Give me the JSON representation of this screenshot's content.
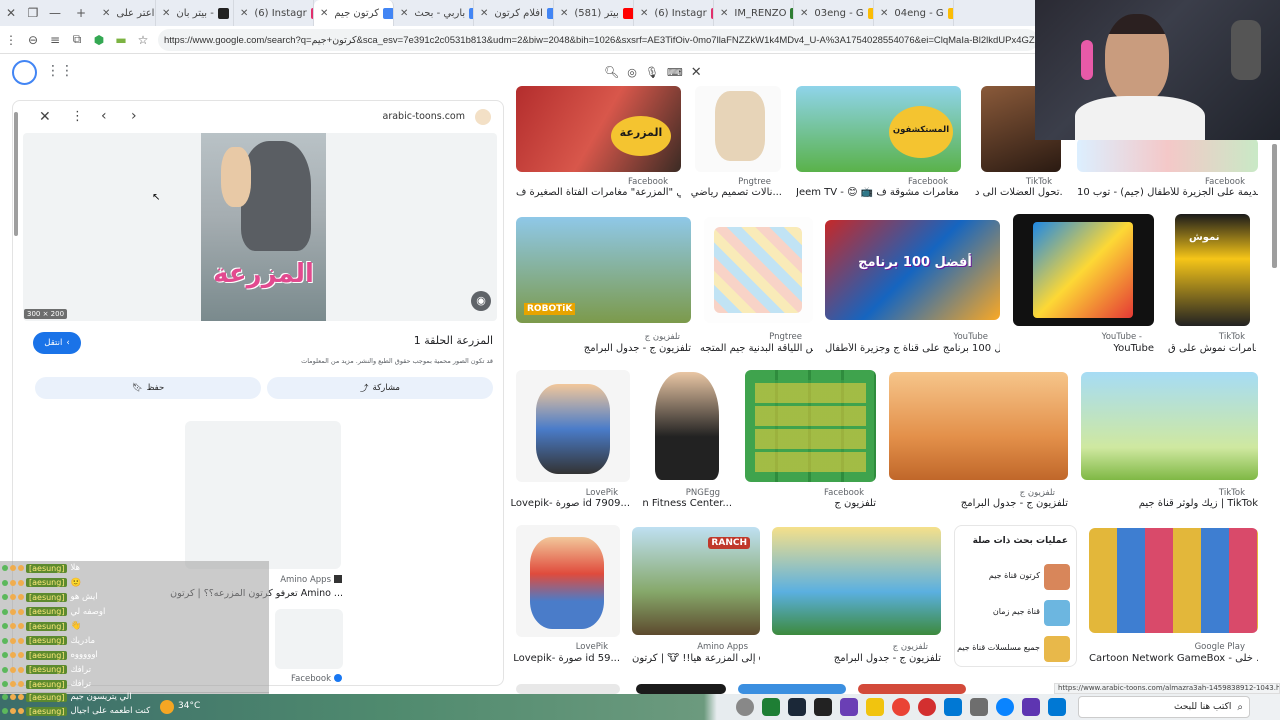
{
  "tabs": [
    {
      "label": "",
      "icon": "close-icon",
      "color": "#555"
    },
    {
      "label": "",
      "icon": "window-icon",
      "color": "#555"
    },
    {
      "label": "",
      "icon": "minimize-icon",
      "color": "#555"
    },
    {
      "label": "",
      "icon": "new-tab-icon",
      "color": "#555"
    },
    {
      "label": "اعتر على",
      "color": "#e53935"
    },
    {
      "label": "بيتر بان -",
      "color": "#222"
    },
    {
      "label": "(6) Instagr",
      "color": "#e1306c"
    },
    {
      "label": "كرتون جيم",
      "color": "#4285f4",
      "active": true
    },
    {
      "label": "باربي - بحث",
      "color": "#4285f4"
    },
    {
      "label": "افلام كرتون",
      "color": "#4285f4"
    },
    {
      "label": "(581) بيتر",
      "color": "#ff0000"
    },
    {
      "label": "(6) Instagr",
      "color": "#e1306c"
    },
    {
      "label": "IM_RENZO",
      "color": "#2e7d32"
    },
    {
      "label": "03eng - G",
      "color": "#fbbc05"
    },
    {
      "label": "04eng - G",
      "color": "#fbbc05"
    }
  ],
  "address": {
    "url": "https://www.google.com/search?q=كرتون+جيم&sca_esv=7e391c2c0531b813&udm=2&biw=2048&bih=1026&sxsrf=AE3TifOiv-0mo7llaFNZZkW1k4MDv4_U-A%3A1754028554076&ei=ClqMaIa-Bl2lkdUPx4GZiQE&ved=0a"
  },
  "panel": {
    "site": "arabic-toons.com",
    "image_size": "300 × 200",
    "preview_word": "المزرعة",
    "visit_label": "انتقل",
    "title": "المزرعة الحلقة 1",
    "copyright": "قد تكون الصور محمية بموجب حقوق الطبع والنشر.  مزيد من المعلومات",
    "share_label": "مشاركة",
    "save_label": "حفظ",
    "related_source": "Amino Apps",
    "related_title": "تعرفو كرتون المزرعه؟؟ | كرتون Amino ...",
    "related_source2": "Facebook"
  },
  "grid": {
    "row1": [
      {
        "src": "Facebook",
        "title": "نشاهد في \"المزرعة\" مغامرات الفتاة الصغيرة ف..."
      },
      {
        "src": "Pngtree",
        "title": "نالات تصميم رياضي..."
      },
      {
        "src": "Facebook",
        "title": "Jeem TV - 😊 📺 في مغامرات مشوقة ف..."
      },
      {
        "src": "TikTok",
        "title": "تحول العضلات الى د..."
      },
      {
        "src": "Facebook",
        "title": "10 برامج قديمة على الجزيرة للأطفال (جيم) - توب..."
      }
    ],
    "row2": [
      {
        "src": "تلفزيون ج",
        "title": "تلفزيون ج - جدول البرامج"
      },
      {
        "src": "Pngtree",
        "title": "درس اللياقة البدنية جيم المتجه..."
      },
      {
        "src": "YouTube",
        "title": "أفضل 100 برنامج على قناة ج وجزيرة الأطفال !..."
      },
      {
        "src": "YouTube -",
        "title": "YouTube"
      },
      {
        "src": "TikTok",
        "title": "مغامرات نموش على ق..."
      }
    ],
    "row3": [
      {
        "src": "LovePik",
        "title": "Lovepik- صورة id 7909..."
      },
      {
        "src": "PNGEgg",
        "title": "n Fitness Center..."
      },
      {
        "src": "Facebook",
        "title": "تلفزيون ج"
      },
      {
        "src": "تلفزيون ج",
        "title": "تلفزيون ج - جدول البرامج"
      },
      {
        "src": "TikTok",
        "title": "زيك ولوثر قناة جيم | TikTok"
      }
    ],
    "row4": [
      {
        "src": "LovePik",
        "title": "Lovepik- صورة id 59..."
      },
      {
        "src": "Amino Apps",
        "title": "إلى المزرعة هيا!! 🐮 | كرتون o..."
      },
      {
        "src": "تلفزيون ج",
        "title": "تلفزيون ج - جدول البرامج"
      },
      {
        "src": "Google Play",
        "title": "Cartoon Network GameBox - خلى ..."
      }
    ],
    "thumb_texts": {
      "mazraa": "المزرعة",
      "mustakshifun": "المستكشفون",
      "robotik": "ROBOTiK",
      "top100": "أفضل 100 برنامج",
      "ranch": "RANCH",
      "nammoush": "نموش"
    }
  },
  "related": {
    "title": "عمليات بحث ذات صلة",
    "items": [
      "كرتون قناة جيم",
      "قناة جيم زمان",
      "جميع مسلسلات قناة جيم"
    ]
  },
  "status_url": "https://www.arabic-toons.com/almazra3ah-1459838912-1043.html",
  "chat": {
    "user": "[aesung]",
    "messages": [
      "هلا",
      "🙂",
      "ايش هو",
      "اوصفه لي",
      "👋",
      "مادريك",
      "اوووووه",
      "ترافك",
      "ترافك",
      "الي يتريسون جيم",
      "كنت اطعمه على اجيال"
    ]
  },
  "taskbar": {
    "weather": "34°C",
    "search_placeholder": "اكتب هنا للبحث"
  }
}
